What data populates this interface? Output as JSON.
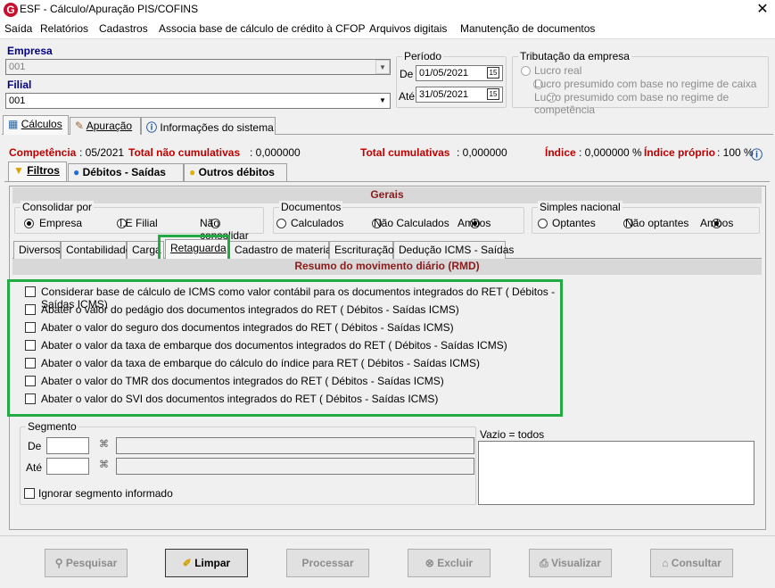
{
  "window": {
    "title": "ESF - Cálculo/Apuração PIS/COFINS",
    "app_icon_letter": "G",
    "close_symbol": "✕"
  },
  "menu": [
    "Saída",
    "Relatórios",
    "Cadastros",
    "Associa base de cálculo de crédito à CFOP",
    "Arquivos digitais",
    "Manutenção de documentos"
  ],
  "empresa": {
    "label": "Empresa",
    "value": "001"
  },
  "filial": {
    "label": "Filial",
    "value": "001"
  },
  "periodo": {
    "title": "Período",
    "de_label": "De",
    "de_value": "01/05/2021",
    "ate_label": "Até",
    "ate_value": "31/05/2021",
    "cal_icon": "15"
  },
  "tributacao": {
    "title": "Tributação da empresa",
    "options": [
      "Lucro real",
      "Lucro presumido com base no regime de caixa",
      "Lucro presumido com base no regime de competência"
    ]
  },
  "main_tabs": [
    "Cálculos",
    "Apuração",
    "Informações do sistema"
  ],
  "status": {
    "competencia_label": "Competência",
    "competencia_value": ": 05/2021",
    "nao_cum_label": "Total não cumulativas",
    "nao_cum_value": ": 0,000000",
    "cum_label": "Total cumulativas",
    "cum_value": ": 0,000000",
    "indice_label": "Índice",
    "indice_value": ": 0,000000 %",
    "indice_proprio_label": "Índice próprio",
    "indice_proprio_value": ": 100 %"
  },
  "sub_tabs": [
    "Filtros",
    "Débitos - Saídas",
    "Outros débitos"
  ],
  "gerais": {
    "header": "Gerais",
    "consolidar": {
      "title": "Consolidar por",
      "options": [
        "Empresa",
        "I.E Filial",
        "Não consolidar"
      ]
    },
    "documentos": {
      "title": "Documentos",
      "options": [
        "Calculados",
        "Não Calculados",
        "Ambos"
      ]
    },
    "simples": {
      "title": "Simples nacional",
      "options": [
        "Optantes",
        "Não optantes",
        "Ambos"
      ]
    }
  },
  "inner_tabs": [
    "Diversos",
    "Contabilidade",
    "Carga",
    "Retaguarda",
    "Cadastro de materiais",
    "Escrituração",
    "Dedução ICMS - Saídas"
  ],
  "rmd": {
    "header": "Resumo do movimento diário (RMD)",
    "checks": [
      "Considerar base de cálculo de ICMS como valor contábil para os documentos integrados do RET ( Débitos - Saídas ICMS)",
      "Abater o valor do pedágio dos documentos integrados do RET ( Débitos - Saídas ICMS)",
      "Abater o valor do seguro dos documentos integrados do RET ( Débitos - Saídas ICMS)",
      "Abater o valor da taxa de embarque dos documentos integrados do RET ( Débitos - Saídas ICMS)",
      "Abater o valor da taxa de embarque do cálculo do índice para RET ( Débitos - Saídas ICMS)",
      "Abater o valor do TMR dos documentos integrados do RET ( Débitos - Saídas ICMS)",
      "Abater o valor do SVI dos documentos integrados do RET ( Débitos - Saídas ICMS)"
    ]
  },
  "segmento": {
    "title": "Segmento",
    "de_label": "De",
    "ate_label": "Até",
    "ignorar_label": "Ignorar segmento informado",
    "vazio_label": "Vazio = todos"
  },
  "buttons": {
    "pesquisar": "Pesquisar",
    "limpar": "Limpar",
    "processar": "Processar",
    "excluir": "Excluir",
    "visualizar": "Visualizar",
    "consultar": "Consultar"
  },
  "colors": {
    "highlight": "#22aa44",
    "status_red": "#c00000",
    "label_blue": "#000080"
  }
}
